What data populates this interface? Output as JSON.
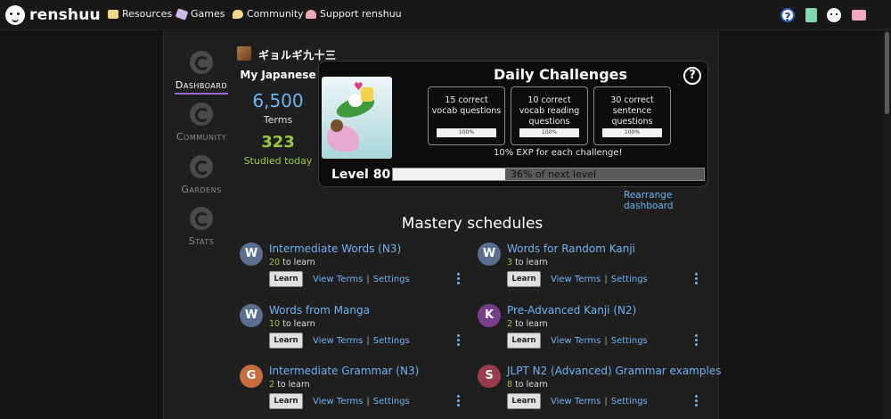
{
  "topbar": {
    "logo_text": "renshuu",
    "nav": [
      {
        "label": "Resources",
        "icon": "book-icon"
      },
      {
        "label": "Games",
        "icon": "dice-icon"
      },
      {
        "label": "Community",
        "icon": "chat-icon"
      },
      {
        "label": "Support renshuu",
        "icon": "heart-icon"
      }
    ],
    "right_icons": [
      "help-icon",
      "notes-icon",
      "profile-face-icon",
      "mail-icon"
    ],
    "help_glyph": "?"
  },
  "sidebar": {
    "items": [
      {
        "label": "Dashboard",
        "active": true
      },
      {
        "label": "Community",
        "active": false
      },
      {
        "label": "Gardens",
        "active": false
      },
      {
        "label": "Stats",
        "active": false
      }
    ]
  },
  "user": {
    "name": "ギョルギ九十三"
  },
  "my_japanese": {
    "title": "My Japanese",
    "terms_value": "6,500",
    "terms_label": "Terms",
    "studied_value": "323",
    "studied_label": "Studied today"
  },
  "daily": {
    "title": "Daily Challenges",
    "help_glyph": "?",
    "challenges": [
      {
        "text": "15 correct vocab questions",
        "progress_label": "100%",
        "progress": 1.0
      },
      {
        "text": "10 correct vocab reading questions",
        "progress_label": "100%",
        "progress": 1.0
      },
      {
        "text": "30 correct sentence questions",
        "progress_label": "100%",
        "progress": 1.0
      }
    ],
    "exp_note": "10% EXP for each challenge!",
    "level_label": "Level 80",
    "level_progress": 0.36,
    "level_progress_label": "36% of next level"
  },
  "rearrange_link": "Rearrange dashboard",
  "mastery": {
    "title": "Mastery schedules",
    "learn_label": "Learn",
    "view_terms_label": "View Terms",
    "settings_label": "Settings",
    "link_separator": "|",
    "count_suffix": "to learn",
    "schedules": [
      {
        "badge": "W",
        "name": "Intermediate Words (N3)",
        "count": "20"
      },
      {
        "badge": "W",
        "name": "Words for Random Kanji",
        "count": "3"
      },
      {
        "badge": "W",
        "name": "Words from Manga",
        "count": "10"
      },
      {
        "badge": "K",
        "name": "Pre-Advanced Kanji (N2)",
        "count": "2"
      },
      {
        "badge": "G",
        "name": "Intermediate Grammar (N3)",
        "count": "2"
      },
      {
        "badge": "S",
        "name": "JLPT N2 (Advanced) Grammar examples",
        "count": "8"
      }
    ]
  }
}
